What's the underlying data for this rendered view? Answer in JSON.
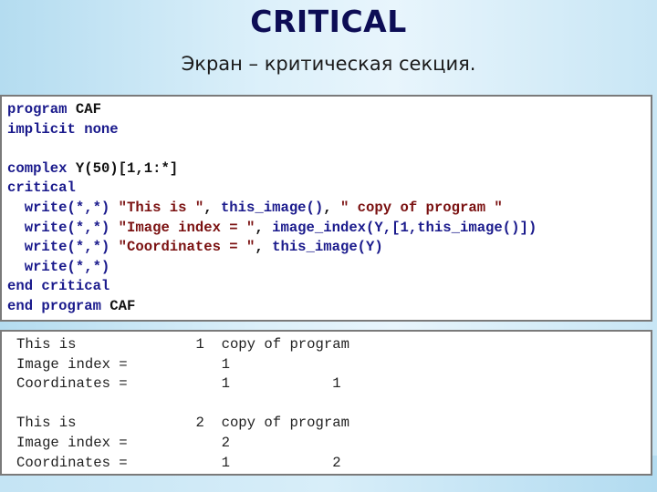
{
  "slide": {
    "title": "CRITICAL",
    "subtitle": "Экран – критическая секция."
  },
  "code": {
    "lines": [
      [
        {
          "t": "program ",
          "c": "kw"
        },
        {
          "t": "CAF",
          "c": "id"
        }
      ],
      [
        {
          "t": "implicit none",
          "c": "kw"
        }
      ],
      [],
      [
        {
          "t": "complex ",
          "c": "kw"
        },
        {
          "t": "Y(50)[1,1:*]",
          "c": "id"
        }
      ],
      [
        {
          "t": "critical",
          "c": "kw"
        }
      ],
      [
        {
          "t": "  write(*,*) ",
          "c": "kw"
        },
        {
          "t": "\"This is \"",
          "c": "str"
        },
        {
          "t": ", ",
          "c": "id"
        },
        {
          "t": "this_image()",
          "c": "kw"
        },
        {
          "t": ", ",
          "c": "id"
        },
        {
          "t": "\" copy of program \"",
          "c": "str"
        }
      ],
      [
        {
          "t": "  write(*,*) ",
          "c": "kw"
        },
        {
          "t": "\"Image index = \"",
          "c": "str"
        },
        {
          "t": ", ",
          "c": "id"
        },
        {
          "t": "image_index(Y,[1,this_image()])",
          "c": "kw"
        }
      ],
      [
        {
          "t": "  write(*,*) ",
          "c": "kw"
        },
        {
          "t": "\"Coordinates = \"",
          "c": "str"
        },
        {
          "t": ", ",
          "c": "id"
        },
        {
          "t": "this_image(Y)",
          "c": "kw"
        }
      ],
      [
        {
          "t": "  write(*,*)",
          "c": "kw"
        }
      ],
      [
        {
          "t": "end critical",
          "c": "kw"
        }
      ],
      [
        {
          "t": "end program ",
          "c": "kw"
        },
        {
          "t": "CAF",
          "c": "id"
        }
      ]
    ]
  },
  "output": {
    "lines": [
      "This is              1  copy of program",
      "Image index =           1",
      "Coordinates =           1            1",
      "",
      "This is              2  copy of program",
      "Image index =           2",
      "Coordinates =           1            2"
    ]
  }
}
